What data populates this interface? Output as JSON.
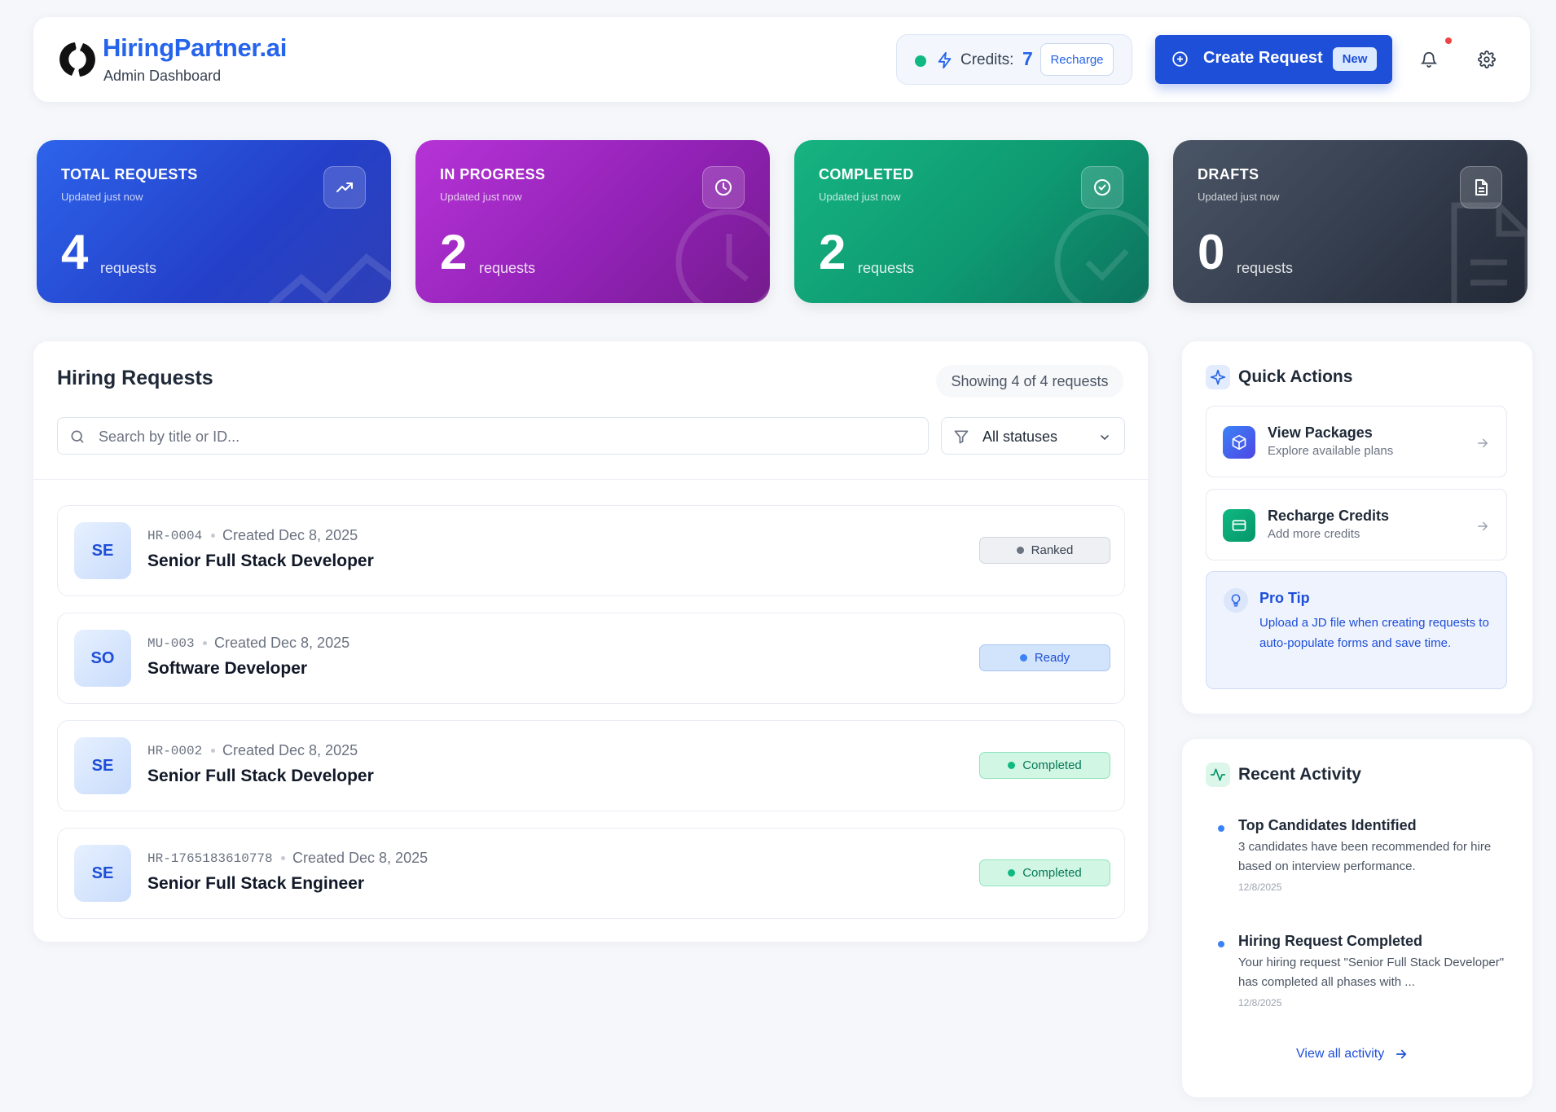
{
  "header": {
    "brand": "HiringPartner.ai",
    "subtitle": "Admin Dashboard",
    "credits_label": "Credits:",
    "credits_value": "7",
    "recharge_label": "Recharge",
    "create_label": "Create Request",
    "new_badge": "New"
  },
  "stats": [
    {
      "title": "TOTAL REQUESTS",
      "sub": "Updated just now",
      "value": "4",
      "unit": "requests",
      "icon": "trending-up-icon",
      "color": "#2563eb"
    },
    {
      "title": "IN PROGRESS",
      "sub": "Updated just now",
      "value": "2",
      "unit": "requests",
      "icon": "clock-icon",
      "color": "#a21caf"
    },
    {
      "title": "COMPLETED",
      "sub": "Updated just now",
      "value": "2",
      "unit": "requests",
      "icon": "check-circle-icon",
      "color": "#059669"
    },
    {
      "title": "DRAFTS",
      "sub": "Updated just now",
      "value": "0",
      "unit": "requests",
      "icon": "document-icon",
      "color": "#374151"
    }
  ],
  "requests": {
    "title": "Hiring Requests",
    "showing": "Showing 4 of 4 requests",
    "search_placeholder": "Search by title or ID...",
    "filter_value": "All statuses",
    "items": [
      {
        "initials": "SE",
        "id": "HR-0004",
        "created": "Created Dec 8, 2025",
        "title": "Senior Full Stack Developer",
        "status": "Ranked"
      },
      {
        "initials": "SO",
        "id": "MU-003",
        "created": "Created Dec 8, 2025",
        "title": "Software Developer",
        "status": "Ready"
      },
      {
        "initials": "SE",
        "id": "HR-0002",
        "created": "Created Dec 8, 2025",
        "title": "Senior Full Stack Developer",
        "status": "Completed"
      },
      {
        "initials": "SE",
        "id": "HR-1765183610778",
        "created": "Created Dec 8, 2025",
        "title": "Senior Full Stack Engineer",
        "status": "Completed"
      }
    ]
  },
  "quick_actions": {
    "title": "Quick Actions",
    "items": [
      {
        "title": "View Packages",
        "sub": "Explore available plans",
        "icon": "package-icon"
      },
      {
        "title": "Recharge Credits",
        "sub": "Add more credits",
        "icon": "credit-card-icon"
      }
    ],
    "tip_title": "Pro Tip",
    "tip_text": "Upload a JD file when creating requests to auto-populate forms and save time."
  },
  "recent_activity": {
    "title": "Recent Activity",
    "items": [
      {
        "title": "Top Candidates Identified",
        "text": "3 candidates have been recommended for hire based on interview performance.",
        "date": "12/8/2025"
      },
      {
        "title": "Hiring Request Completed",
        "text": "Your hiring request \"Senior Full Stack Developer\" has completed all phases with ...",
        "date": "12/8/2025"
      }
    ],
    "view_all": "View all activity"
  }
}
